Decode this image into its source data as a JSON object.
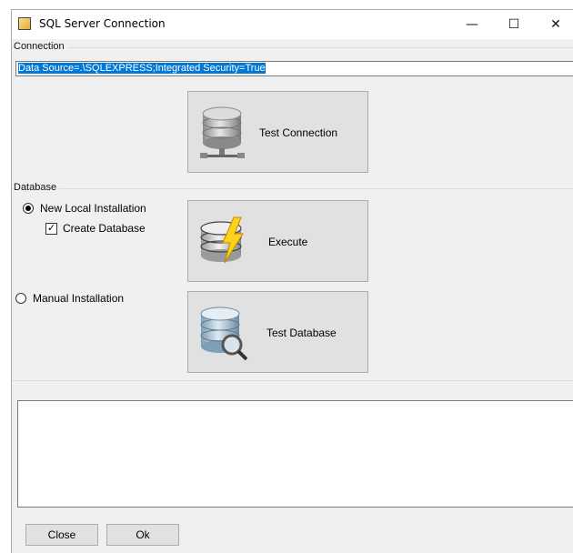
{
  "window": {
    "title": "SQL Server Connection",
    "minimize_glyph": "—",
    "maximize_glyph": "☐",
    "close_glyph": "✕"
  },
  "connection": {
    "group_label": "Connection",
    "connection_string": "Data Source=.\\SQLEXPRESS;Integrated Security=True",
    "test_button_label": "Test Connection"
  },
  "database": {
    "group_label": "Database",
    "new_local_label": "New Local Installation",
    "new_local_selected": true,
    "create_db_label": "Create Database",
    "create_db_checked": true,
    "manual_label": "Manual Installation",
    "manual_selected": false,
    "execute_button_label": "Execute",
    "test_db_button_label": "Test Database"
  },
  "output": {
    "text": ""
  },
  "footer": {
    "close_label": "Close",
    "ok_label": "Ok"
  },
  "icons": {
    "app": "app-icon",
    "connection": "database-network-icon",
    "execute": "database-lightning-icon",
    "test_db": "database-magnifier-icon"
  }
}
